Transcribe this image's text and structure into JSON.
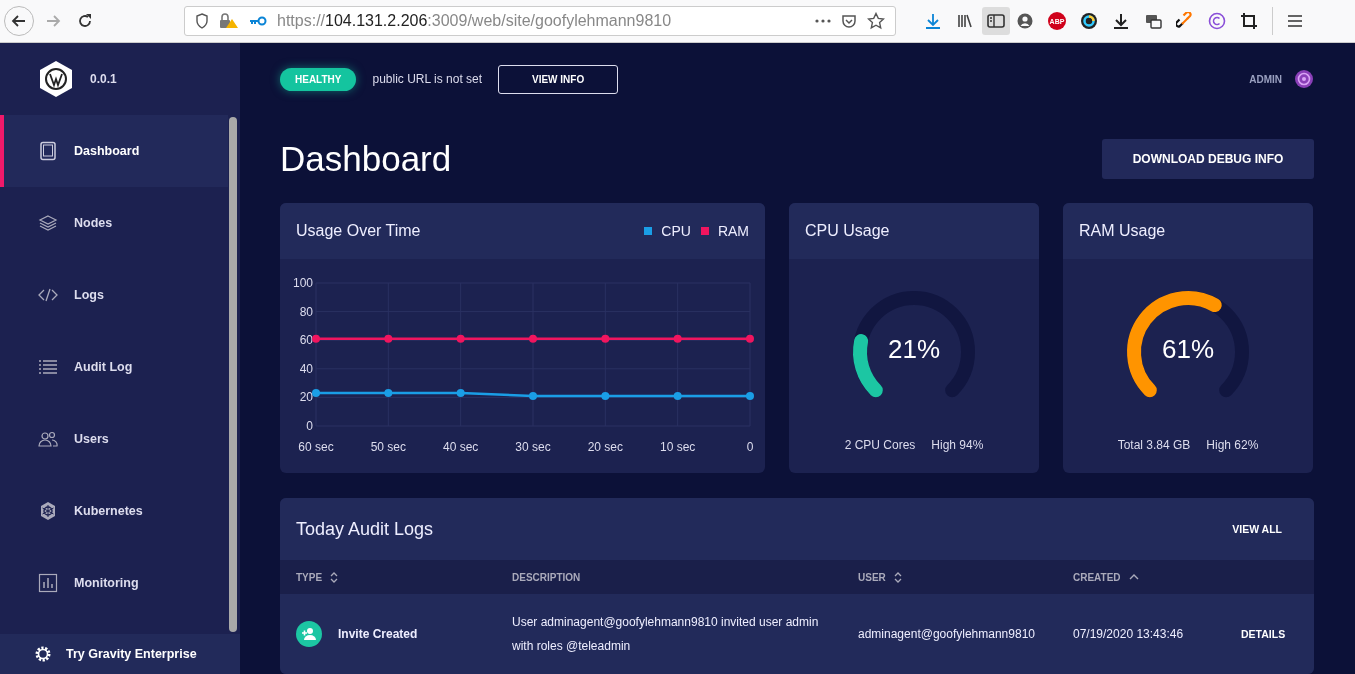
{
  "browser": {
    "url_scheme": "https://",
    "url_host": "104.131.2.206",
    "url_rest": ":3009/web/site/goofylehmann9810",
    "adblock_label": "ABP"
  },
  "sidebar": {
    "version": "0.0.1",
    "items": [
      {
        "label": "Dashboard",
        "selected": true
      },
      {
        "label": "Nodes",
        "selected": false
      },
      {
        "label": "Logs",
        "selected": false
      },
      {
        "label": "Audit Log",
        "selected": false
      },
      {
        "label": "Users",
        "selected": false
      },
      {
        "label": "Kubernetes",
        "selected": false
      },
      {
        "label": "Monitoring",
        "selected": false
      }
    ],
    "footer": "Try Gravity Enterprise"
  },
  "topbar": {
    "status": "HEALTHY",
    "message": "public URL is not set",
    "button": "VIEW INFO",
    "user": "ADMIN"
  },
  "page": {
    "title": "Dashboard",
    "action": "DOWNLOAD DEBUG INFO"
  },
  "usage_card": {
    "title": "Usage Over Time",
    "chart_data": {
      "type": "line",
      "categories": [
        "60 sec",
        "50 sec",
        "40 sec",
        "30 sec",
        "20 sec",
        "10 sec",
        "0"
      ],
      "ylim": [
        0,
        100
      ],
      "grid": true,
      "yticks": [
        0,
        20,
        40,
        60,
        80,
        100
      ],
      "series": [
        {
          "name": "CPU",
          "color": "#1a9ee6",
          "marker": true,
          "values": [
            23,
            23,
            23,
            21,
            21,
            21,
            21
          ]
        },
        {
          "name": "RAM",
          "color": "#f0155f",
          "marker": true,
          "values": [
            61,
            61,
            61,
            61,
            61,
            61,
            61
          ]
        }
      ]
    }
  },
  "gauges": [
    {
      "title": "CPU Usage",
      "reading": "21%",
      "color": "#1cc6a3",
      "stats": [
        "2 CPU Cores",
        "High 94%"
      ]
    },
    {
      "title": "RAM Usage",
      "reading": "61%",
      "color": "#ff9400",
      "stats": [
        "Total 3.84 GB",
        "High 62%"
      ]
    }
  ],
  "audit": {
    "title": "Today Audit Logs",
    "action": "VIEW ALL",
    "columns": [
      {
        "label": "TYPE",
        "sortable": true,
        "sorted": false
      },
      {
        "label": "DESCRIPTION",
        "sortable": false
      },
      {
        "label": "USER",
        "sortable": true,
        "sorted": false
      },
      {
        "label": "CREATED",
        "sortable": true,
        "sorted": true
      }
    ],
    "rows": [
      {
        "type": "Invite Created",
        "description": "User adminagent@goofylehmann9810 invited user admin with roles @teleadmin",
        "user": "adminagent@goofylehmann9810",
        "created": "07/19/2020 13:43:46",
        "action": "DETAILS"
      }
    ]
  }
}
